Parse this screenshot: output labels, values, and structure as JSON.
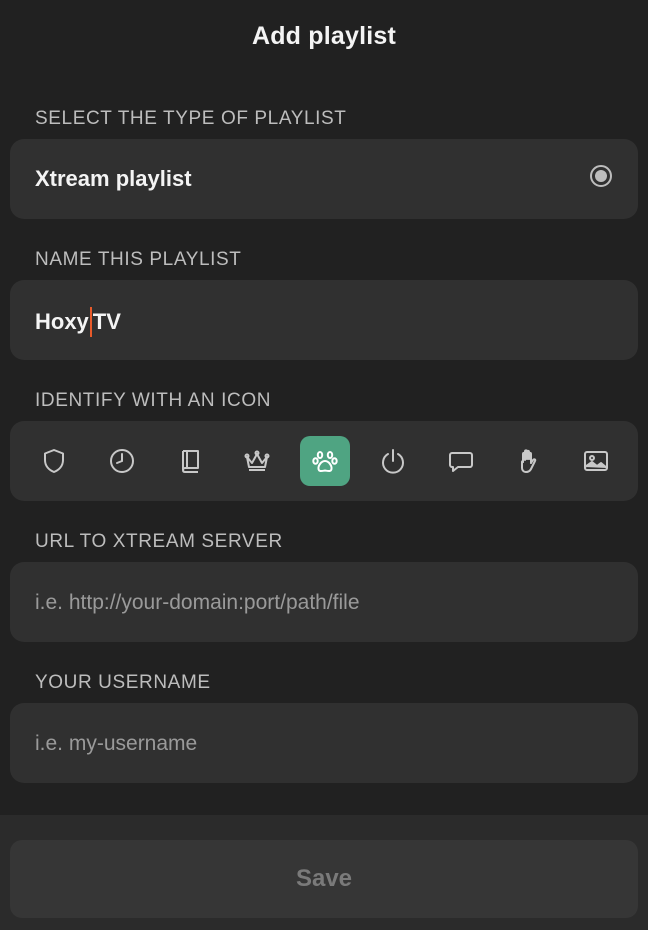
{
  "header": {
    "title": "Add playlist"
  },
  "type_section": {
    "label": "SELECT THE TYPE OF PLAYLIST",
    "option": "Xtream playlist"
  },
  "name_section": {
    "label": "NAME THIS PLAYLIST",
    "value_before_caret": "Hoxy",
    "value_after_caret": "TV"
  },
  "icon_section": {
    "label": "IDENTIFY WITH AN ICON",
    "icons": [
      "shield-icon",
      "clock-icon",
      "book-icon",
      "crown-icon",
      "paw-icon",
      "power-icon",
      "chat-icon",
      "hand-icon",
      "image-icon"
    ],
    "selected": "paw-icon",
    "selected_color": "#4fa482"
  },
  "url_section": {
    "label": "URL TO XTREAM SERVER",
    "placeholder": "i.e. http://your-domain:port/path/file"
  },
  "username_section": {
    "label": "YOUR USERNAME",
    "placeholder": "i.e. my-username"
  },
  "footer": {
    "save_label": "Save"
  }
}
